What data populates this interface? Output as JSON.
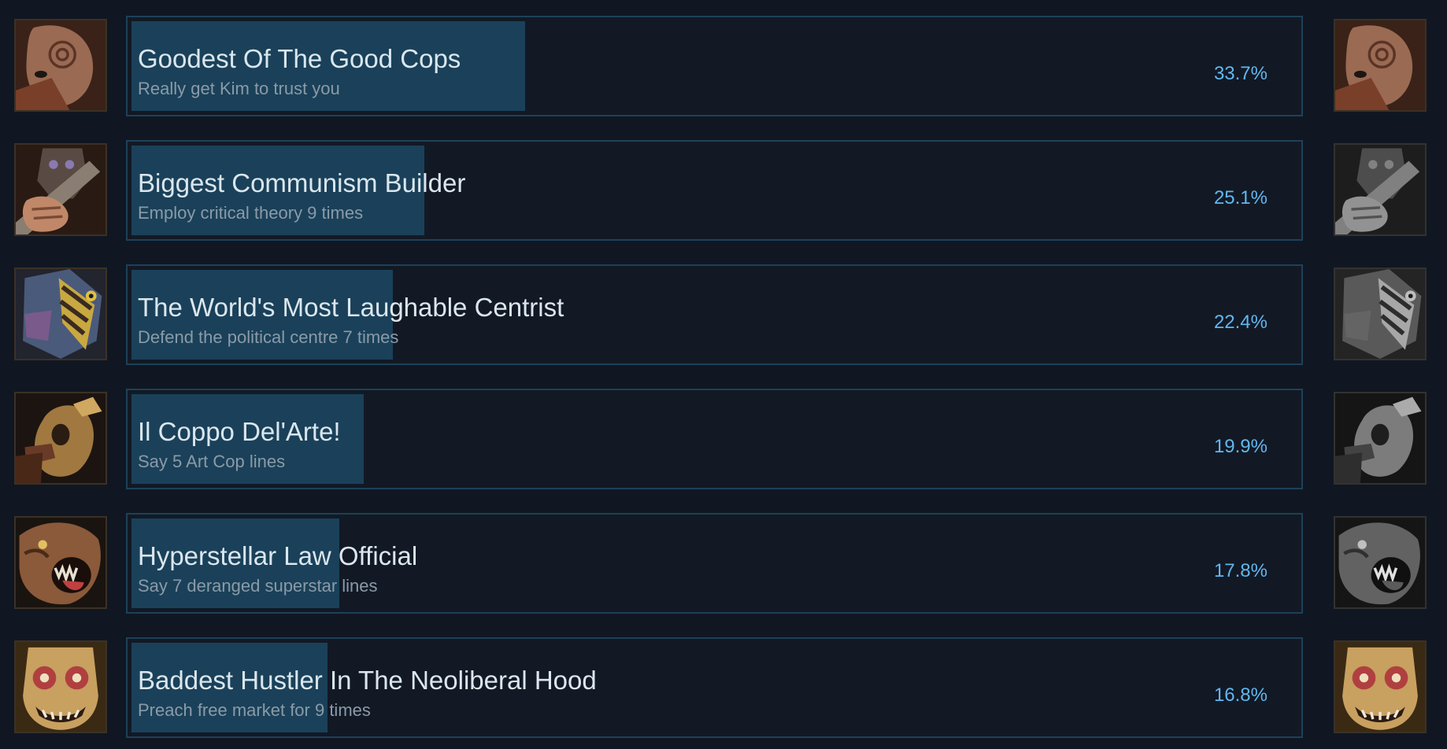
{
  "achievements": [
    {
      "title": "Goodest Of The Good Cops",
      "description": "Really get Kim to trust you",
      "percent": "33.7%",
      "percent_value": 33.7,
      "left_icon": "kim-mask-icon",
      "right_icon": "kim-mask-icon",
      "right_icon_unlocked": true
    },
    {
      "title": "Biggest Communism Builder",
      "description": "Employ critical theory 9 times",
      "percent": "25.1%",
      "percent_value": 25.1,
      "left_icon": "communist-mask-icon",
      "right_icon": "communist-mask-icon",
      "right_icon_unlocked": false
    },
    {
      "title": "The World's Most Laughable Centrist",
      "description": "Defend the political centre 7 times",
      "percent": "22.4%",
      "percent_value": 22.4,
      "left_icon": "centrist-mask-icon",
      "right_icon": "centrist-mask-icon",
      "right_icon_unlocked": false
    },
    {
      "title": "Il Coppo Del'Arte!",
      "description": "Say 5 Art Cop lines",
      "percent": "19.9%",
      "percent_value": 19.9,
      "left_icon": "art-cop-figure-icon",
      "right_icon": "art-cop-figure-icon",
      "right_icon_unlocked": false
    },
    {
      "title": "Hyperstellar Law Official",
      "description": "Say 7 deranged superstar lines",
      "percent": "17.8%",
      "percent_value": 17.8,
      "left_icon": "superstar-beast-icon",
      "right_icon": "superstar-beast-icon",
      "right_icon_unlocked": false
    },
    {
      "title": "Baddest Hustler In The Neoliberal Hood",
      "description": "Preach free market for 9 times",
      "percent": "16.8%",
      "percent_value": 16.8,
      "left_icon": "ultraliberal-mask-icon",
      "right_icon": "ultraliberal-mask-icon",
      "right_icon_unlocked": true
    }
  ],
  "colors": {
    "background": "#101722",
    "panel_border": "#1d4159",
    "progress_fill": "#1a4159",
    "title_text": "#dbe6ee",
    "description_text": "#8b9aa8",
    "percent_text": "#62b7ef"
  }
}
